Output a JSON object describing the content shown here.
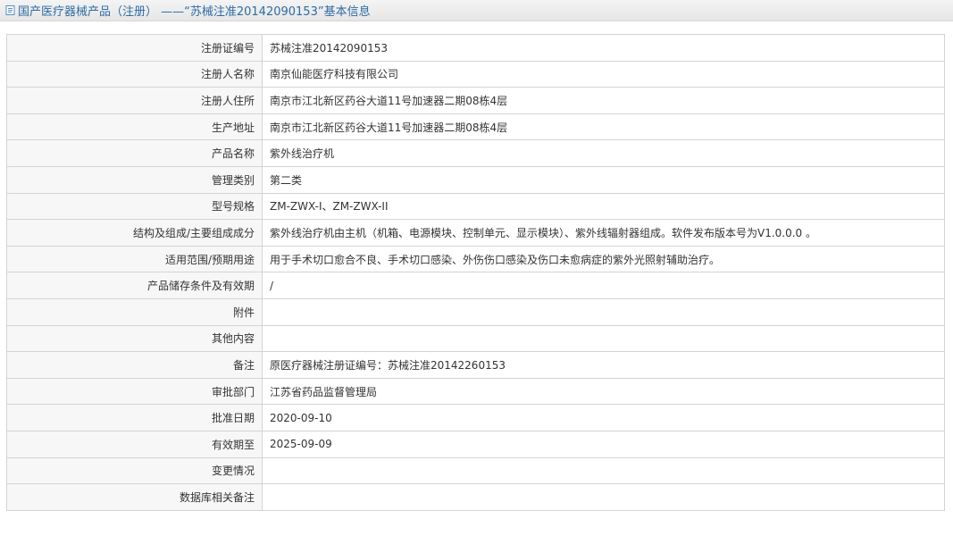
{
  "header": {
    "icon": "document-icon",
    "title": "国产医疗器械产品（注册） ——“苏械注准20142090153”基本信息"
  },
  "fields": [
    {
      "label": "注册证编号",
      "value": "苏械注准20142090153"
    },
    {
      "label": "注册人名称",
      "value": "南京仙能医疗科技有限公司"
    },
    {
      "label": "注册人住所",
      "value": "南京市江北新区药谷大道11号加速器二期08栋4层"
    },
    {
      "label": "生产地址",
      "value": "南京市江北新区药谷大道11号加速器二期08栋4层"
    },
    {
      "label": "产品名称",
      "value": "紫外线治疗机"
    },
    {
      "label": "管理类别",
      "value": "第二类"
    },
    {
      "label": "型号规格",
      "value": "ZM-ZWX-I、ZM-ZWX-II"
    },
    {
      "label": "结构及组成/主要组成成分",
      "value": "紫外线治疗机由主机（机箱、电源模块、控制单元、显示模块）、紫外线辐射器组成。软件发布版本号为V1.0.0.0 。"
    },
    {
      "label": "适用范围/预期用途",
      "value": "用于手术切口愈合不良、手术切口感染、外伤伤口感染及伤口未愈病症的紫外光照射辅助治疗。"
    },
    {
      "label": "产品储存条件及有效期",
      "value": "/"
    },
    {
      "label": "附件",
      "value": ""
    },
    {
      "label": "其他内容",
      "value": ""
    },
    {
      "label": "备注",
      "value": "原医疗器械注册证编号：苏械注准20142260153"
    },
    {
      "label": "审批部门",
      "value": "江苏省药品监督管理局"
    },
    {
      "label": "批准日期",
      "value": "2020-09-10"
    },
    {
      "label": "有效期至",
      "value": "2025-09-09"
    },
    {
      "label": "变更情况",
      "value": ""
    },
    {
      "label": "数据库相关备注",
      "value": ""
    }
  ]
}
